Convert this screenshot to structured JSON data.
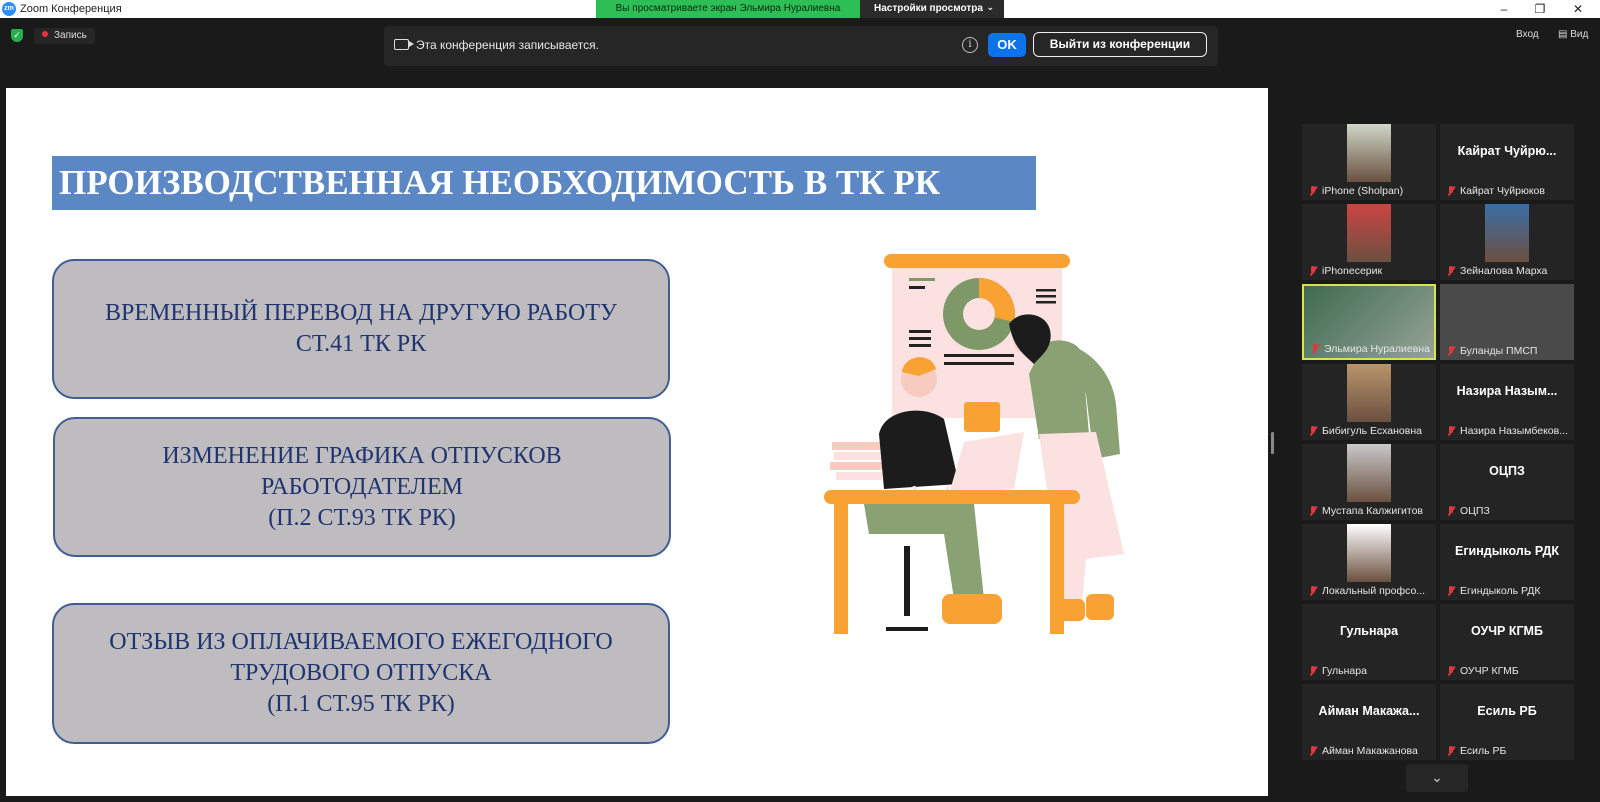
{
  "window": {
    "title": "Zoom Конференция",
    "logo": "zm",
    "share_banner": "Вы просматриваете экран Эльмира Нуралиевна",
    "view_settings": "Настройки просмотра",
    "view_settings_chevron": "⌄",
    "minimize": "–",
    "maximize": "❐",
    "close": "✕"
  },
  "toolbar": {
    "shield_glyph": "✓",
    "record_label": "Запись",
    "recording_notice": "Эта конференция записывается.",
    "info_glyph": "i",
    "ok_label": "OK",
    "leave_label": "Выйти из конференции",
    "signin_label": "Вход",
    "view_label": "Вид",
    "view_icon_glyph": "▤"
  },
  "slide": {
    "title": "ПРОИЗВОДСТВЕННАЯ НЕОБХОДИМОСТЬ В ТК РК",
    "boxes": [
      {
        "lines": [
          "ВРЕМЕННЫЙ ПЕРЕВОД НА ДРУГУЮ РАБОТУ",
          "СТ.41 ТК РК"
        ]
      },
      {
        "lines": [
          "ИЗМЕНЕНИЕ ГРАФИКА ОТПУСКОВ",
          "РАБОТОДАТЕЛЕМ",
          "(П.2 СТ.93 ТК РК)"
        ]
      },
      {
        "lines": [
          "ОТЗЫВ ИЗ ОПЛАЧИВАЕМОГО ЕЖЕГОДНОГО",
          "ТРУДОВОГО ОТПУСКА",
          "(П.1 СТ.95 ТК РК)"
        ]
      }
    ]
  },
  "participants": [
    {
      "name": "iPhone (Sholpan)",
      "big": "",
      "has_video": true
    },
    {
      "name": "Кайрат  Чуйрюков",
      "big": "Кайрат  Чуйрю...",
      "has_video": false
    },
    {
      "name": "iPhoneсерик",
      "big": "",
      "has_video": true
    },
    {
      "name": "Зейналова Марха",
      "big": "",
      "has_video": true
    },
    {
      "name": "Эльмира Нуралиевна",
      "big": "",
      "has_video": true,
      "active": true
    },
    {
      "name": "Буланды ПМСП",
      "big": "",
      "has_video": true
    },
    {
      "name": "Бибигуль Есхановна",
      "big": "",
      "has_video": true
    },
    {
      "name": "Назира Назымбеков...",
      "big": "Назира  Назым...",
      "has_video": false
    },
    {
      "name": "Мустапа Калжигитов",
      "big": "",
      "has_video": true
    },
    {
      "name": "ОЦПЗ",
      "big": "ОЦПЗ",
      "has_video": false
    },
    {
      "name": "Локальный профсо...",
      "big": "",
      "has_video": true
    },
    {
      "name": "Егиндыколь РДК",
      "big": "Егиндыколь РДК",
      "has_video": false
    },
    {
      "name": "Гульнара",
      "big": "Гульнара",
      "has_video": false
    },
    {
      "name": "ОУЧР КГМБ",
      "big": "ОУЧР КГМБ",
      "has_video": false
    },
    {
      "name": "Айман Макажанова",
      "big": "Айман  Макажа...",
      "has_video": false
    },
    {
      "name": "Есиль РБ",
      "big": "Есиль РБ",
      "has_video": false
    }
  ],
  "scroll_down_glyph": "⌄",
  "colors": {
    "slide_title_bg": "#5b87c5",
    "box_bg": "#bfbcbf",
    "box_text": "#1f3470",
    "accent_blue": "#0e72ed",
    "share_green": "#2dbf56",
    "active_speaker": "#d7e34b",
    "mic_muted": "#e0383e"
  }
}
